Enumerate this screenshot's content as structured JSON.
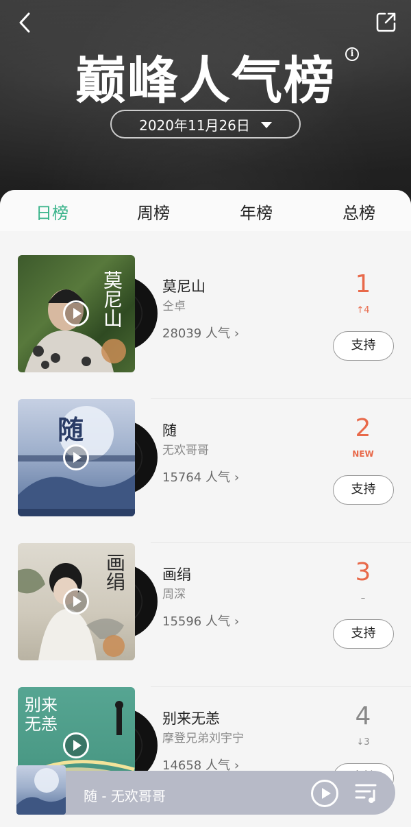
{
  "header": {
    "title": "巅峰人气榜",
    "date": "2020年11月26日"
  },
  "tabs": [
    {
      "label": "日榜",
      "active": true
    },
    {
      "label": "周榜",
      "active": false
    },
    {
      "label": "年榜",
      "active": false
    },
    {
      "label": "总榜",
      "active": false
    }
  ],
  "songs": [
    {
      "title": "莫尼山",
      "artist": "仝卓",
      "popularity": "28039 人气",
      "rank": "1",
      "trend": "↑4",
      "trend_color": "#e8694a",
      "rank_color": "#e8694a",
      "support": "支持",
      "cover_text": "莫尼山"
    },
    {
      "title": "随",
      "artist": "无欢哥哥",
      "popularity": "15764 人气",
      "rank": "2",
      "trend": "NEW",
      "trend_color": "#e8694a",
      "rank_color": "#e8694a",
      "support": "支持",
      "cover_text": "随"
    },
    {
      "title": "画绢",
      "artist": "周深",
      "popularity": "15596 人气",
      "rank": "3",
      "trend": "–",
      "trend_color": "#888888",
      "rank_color": "#e8694a",
      "support": "支持",
      "cover_text": "画绢"
    },
    {
      "title": "别来无恙",
      "artist": "摩登兄弟刘宇宁",
      "popularity": "14658 人气",
      "rank": "4",
      "trend": "↓3",
      "trend_color": "#888888",
      "rank_color": "#888888",
      "support": "支持",
      "cover_text": "别来无恙"
    }
  ],
  "player": {
    "now_playing": "随 - 无欢哥哥"
  },
  "colors": {
    "accent": "#39b38a",
    "rank_top": "#e8694a"
  },
  "icons": [
    "back-icon",
    "share-icon",
    "info-icon",
    "play-icon",
    "playlist-icon"
  ]
}
